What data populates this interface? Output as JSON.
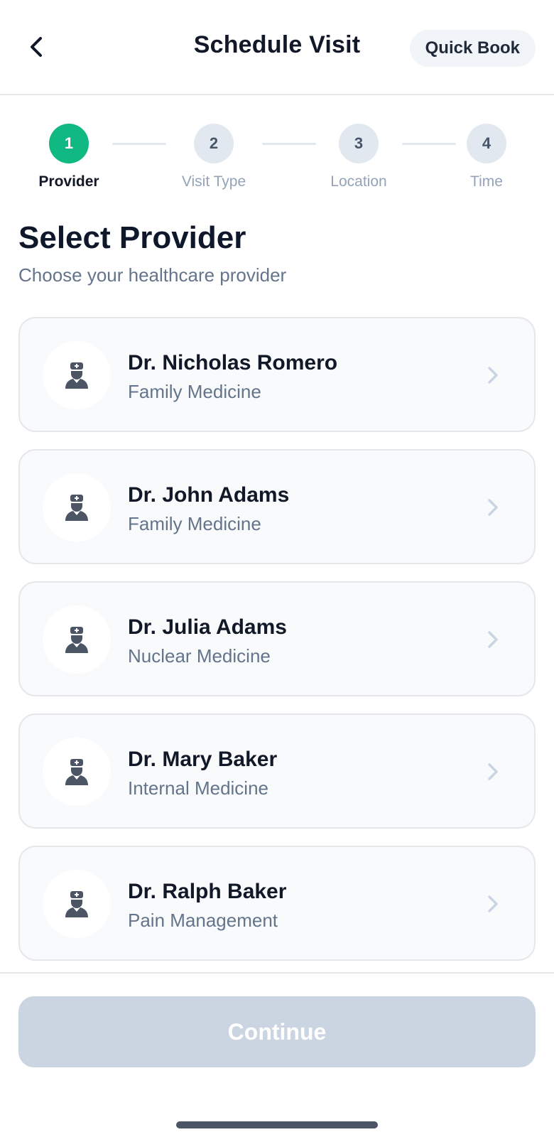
{
  "header": {
    "title": "Schedule Visit",
    "back_icon": "chevron-left-icon",
    "quick_book_label": "Quick Book"
  },
  "stepper": {
    "steps": [
      {
        "number": "1",
        "label": "Provider",
        "state": "active"
      },
      {
        "number": "2",
        "label": "Visit Type",
        "state": "pending"
      },
      {
        "number": "3",
        "label": "Location",
        "state": "pending"
      },
      {
        "number": "4",
        "label": "Time",
        "state": "pending"
      }
    ]
  },
  "section": {
    "title": "Select Provider",
    "subtitle": "Choose your healthcare provider"
  },
  "providers": [
    {
      "name": "Dr. Nicholas Romero",
      "specialty": "Family Medicine",
      "icon": "doctor-icon"
    },
    {
      "name": "Dr. John Adams",
      "specialty": "Family Medicine",
      "icon": "doctor-icon"
    },
    {
      "name": "Dr. Julia Adams",
      "specialty": "Nuclear Medicine",
      "icon": "doctor-icon"
    },
    {
      "name": "Dr. Mary Baker",
      "specialty": "Internal Medicine",
      "icon": "doctor-icon"
    },
    {
      "name": "Dr. Ralph Baker",
      "specialty": "Pain Management",
      "icon": "doctor-icon"
    }
  ],
  "footer": {
    "continue_label": "Continue",
    "continue_enabled": false
  },
  "colors": {
    "accent": "#10b981",
    "step_inactive": "#e2e8f0",
    "button_disabled": "#cbd5e1",
    "text_primary": "#111827",
    "text_secondary": "#64748b"
  }
}
